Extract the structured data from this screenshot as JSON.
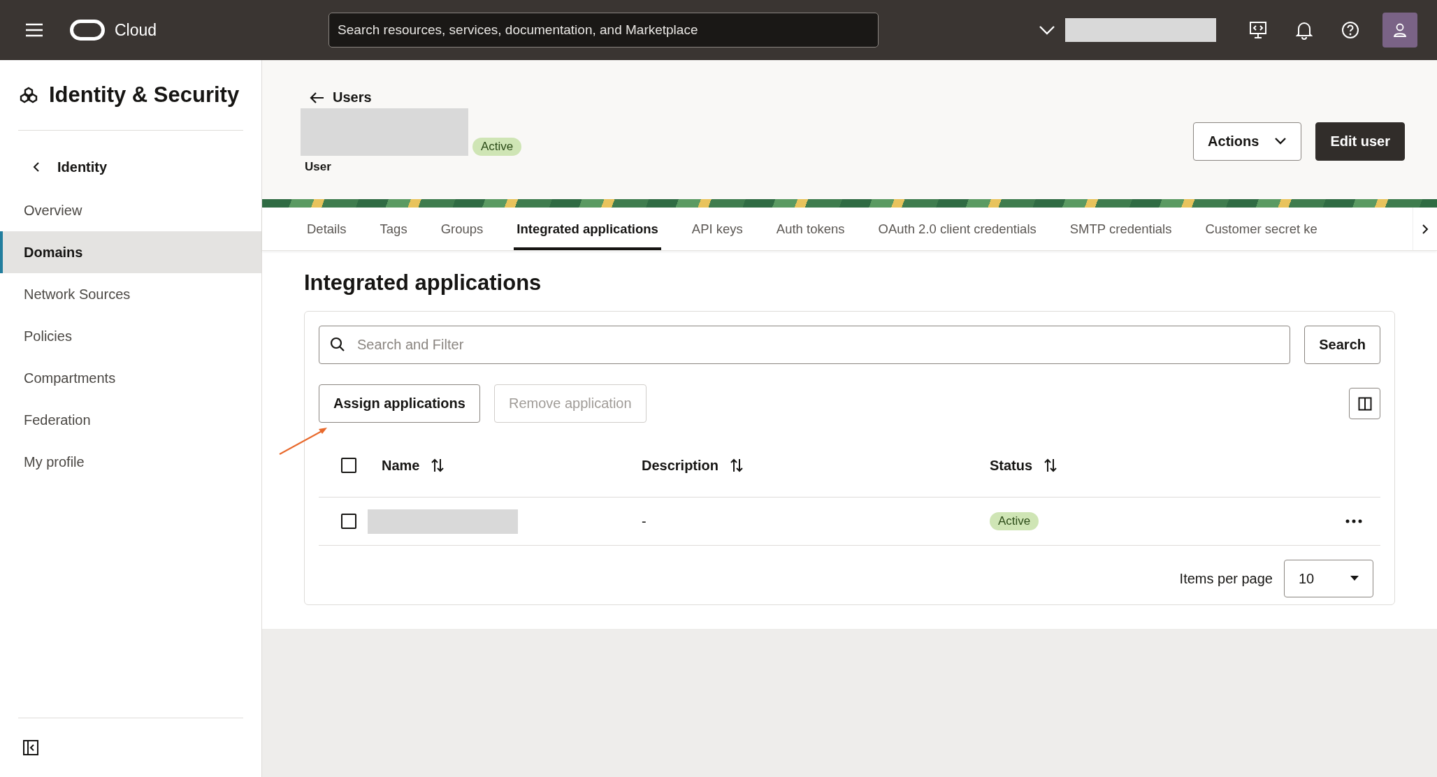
{
  "header": {
    "brand": "Cloud",
    "search": {
      "placeholder": "Search resources, services, documentation, and Marketplace"
    }
  },
  "sidebar": {
    "title": "Identity & Security",
    "back": "Identity",
    "items": [
      {
        "label": "Overview",
        "selected": false
      },
      {
        "label": "Domains",
        "selected": true
      },
      {
        "label": "Network Sources",
        "selected": false
      },
      {
        "label": "Policies",
        "selected": false
      },
      {
        "label": "Compartments",
        "selected": false
      },
      {
        "label": "Federation",
        "selected": false
      },
      {
        "label": "My profile",
        "selected": false
      }
    ]
  },
  "page": {
    "back": "Users",
    "status": "Active",
    "subtitle": "User",
    "actions": "Actions",
    "edit": "Edit user"
  },
  "tabs": [
    {
      "label": "Details",
      "selected": false
    },
    {
      "label": "Tags",
      "selected": false
    },
    {
      "label": "Groups",
      "selected": false
    },
    {
      "label": "Integrated applications",
      "selected": true
    },
    {
      "label": "API keys",
      "selected": false
    },
    {
      "label": "Auth tokens",
      "selected": false
    },
    {
      "label": "OAuth 2.0 client credentials",
      "selected": false
    },
    {
      "label": "SMTP credentials",
      "selected": false
    },
    {
      "label": "Customer secret ke",
      "selected": false
    }
  ],
  "section": {
    "title": "Integrated applications",
    "search": {
      "placeholder": "Search and Filter"
    },
    "search_button": "Search",
    "buttons": [
      {
        "label": "Assign applications",
        "disabled": false
      },
      {
        "label": "Remove application",
        "disabled": true
      }
    ],
    "table": {
      "columns": [
        "Name",
        "Description",
        "Status"
      ],
      "select_all": {
        "checked": false
      },
      "rows": [
        {
          "checked": false,
          "description": "-",
          "status": "Active"
        }
      ]
    },
    "pagination": {
      "label": "Items per page",
      "value": "10"
    }
  }
}
